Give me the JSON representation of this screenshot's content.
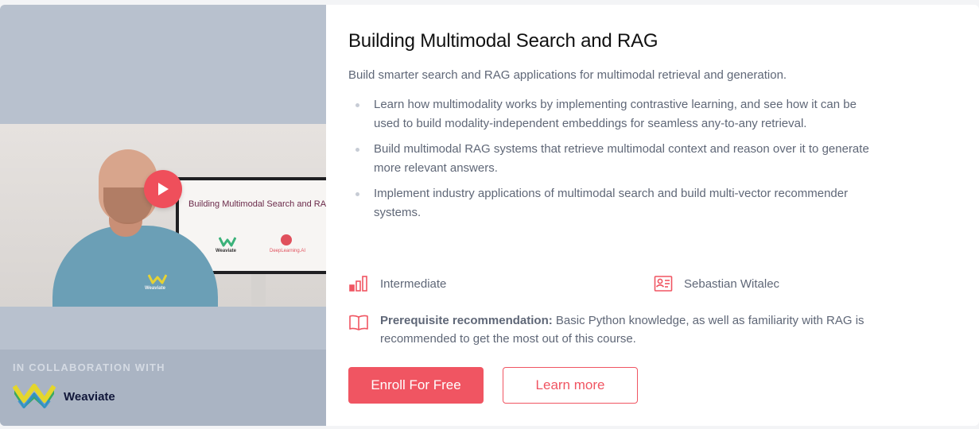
{
  "course": {
    "title": "Building Multimodal Search and RAG",
    "subtitle": "Build smarter search and RAG applications for multimodal retrieval and generation.",
    "bullets": [
      "Learn how multimodality works by implementing contrastive learning, and see how it can be used to build modality-independent embeddings for seamless any-to-any retrieval.",
      "Build multimodal RAG systems that retrieve multimodal context and reason over it to generate more relevant answers.",
      "Implement industry applications of multimodal search and build multi-vector recommender systems."
    ],
    "level": "Intermediate",
    "instructor": "Sebastian Witalec",
    "prereq_label": "Prerequisite recommendation:",
    "prereq_text": "Basic Python knowledge, as well as familiarity with RAG is recommended to get the most out of this course.",
    "enroll_label": "Enroll For Free",
    "learn_label": "Learn more"
  },
  "video": {
    "screen_title": "Building Multimodal Search and RAG",
    "screen_logo1": "Weaviate",
    "screen_logo2": "DeepLearning.AI",
    "shirt_text": "Weaviate",
    "play_icon": "play-icon"
  },
  "collaboration": {
    "label": "IN COLLABORATION WITH",
    "partner": "Weaviate"
  },
  "colors": {
    "accent": "#f05562",
    "text": "#5f6777",
    "panel": "#b8c1ce"
  }
}
